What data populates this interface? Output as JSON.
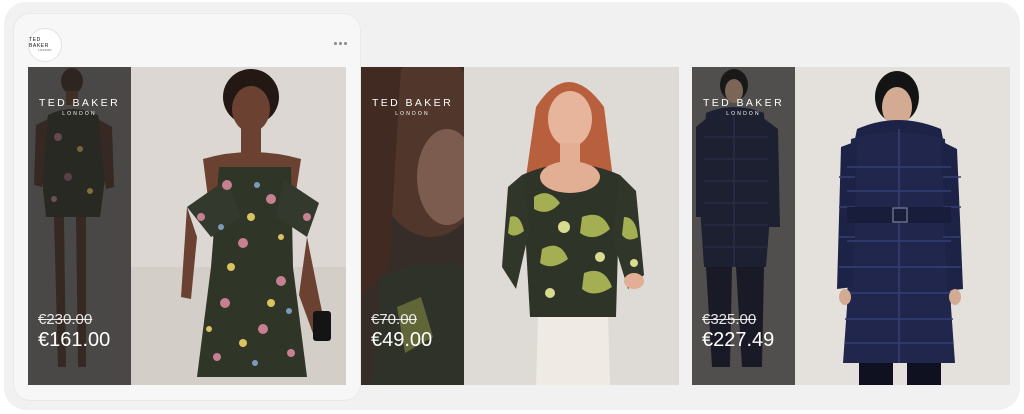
{
  "brand": {
    "logo_line1": "TED BAKER",
    "logo_line2": "LONDON"
  },
  "colors": {
    "backdrop": "#f1f1f1",
    "card": "#f7f7f7",
    "overlay_text": "#ffffff",
    "studio_bg": "#e4e0dd"
  },
  "header": {
    "more_icon": "ellipsis-icon"
  },
  "products": [
    {
      "brand_line1": "TED BAKER",
      "brand_line2": "LONDON",
      "original_price": "€230.00",
      "sale_price": "€161.00",
      "garment": "floral cold-shoulder playsuit"
    },
    {
      "brand_line1": "TED BAKER",
      "brand_line2": "LONDON",
      "original_price": "€70.00",
      "sale_price": "€49.00",
      "garment": "green printed scoop-neck top"
    },
    {
      "brand_line1": "TED BAKER",
      "brand_line2": "LONDON",
      "original_price": "€325.00",
      "sale_price": "€227.49",
      "garment": "navy belted long puffer coat"
    }
  ]
}
